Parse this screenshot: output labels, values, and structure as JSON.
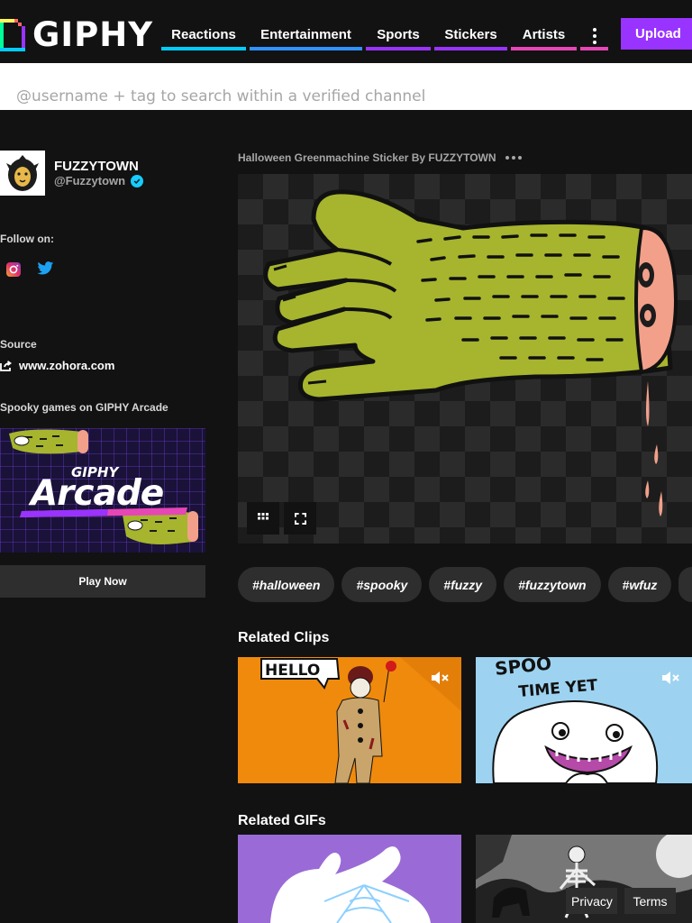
{
  "header": {
    "logo_text": "GIPHY",
    "nav": [
      {
        "label": "Reactions",
        "color": "#00ccff"
      },
      {
        "label": "Entertainment",
        "color": "#3191ff"
      },
      {
        "label": "Sports",
        "color": "#9933ff"
      },
      {
        "label": "Stickers",
        "color": "#9933ff"
      },
      {
        "label": "Artists",
        "color": "#e646b6"
      }
    ],
    "more_icon": "vertical-dots-icon",
    "upload_label": "Upload",
    "upload_color": "#9933ff"
  },
  "search": {
    "placeholder": "@username + tag to search within a verified channel",
    "value": ""
  },
  "sidebar": {
    "channel_name": "FUZZYTOWN",
    "channel_handle": "@Fuzzytown",
    "follow_label": "Follow on:",
    "social": [
      "instagram-icon",
      "twitter-icon"
    ],
    "source_label": "Source",
    "source_link": "www.zohora.com",
    "arcade_title": "Spooky games on GIPHY Arcade",
    "arcade_logo_small": "GIPHY",
    "arcade_logo_big": "Arcade",
    "play_now_label": "Play Now"
  },
  "main": {
    "gif_title": "Halloween Greenmachine Sticker By FUZZYTOWN",
    "tags": [
      "#halloween",
      "#spooky",
      "#fuzzy",
      "#fuzzytown",
      "#wfuz"
    ],
    "related_clips_title": "Related Clips",
    "related_gifs_title": "Related GIFs",
    "clips": [
      {
        "caption": "HELLO",
        "bg": "#f08a0c"
      },
      {
        "caption": "SPOOKY TIME YET",
        "bg": "#9dd3f0"
      }
    ]
  },
  "footer": {
    "privacy_label": "Privacy",
    "terms_label": "Terms"
  },
  "colors": {
    "background": "#121212",
    "accent_cyan": "#00ccff",
    "accent_blue": "#3191ff",
    "accent_purple": "#9933ff",
    "accent_pink": "#e646b6",
    "verified": "#15cdff",
    "monster_green": "#a6b52d"
  }
}
